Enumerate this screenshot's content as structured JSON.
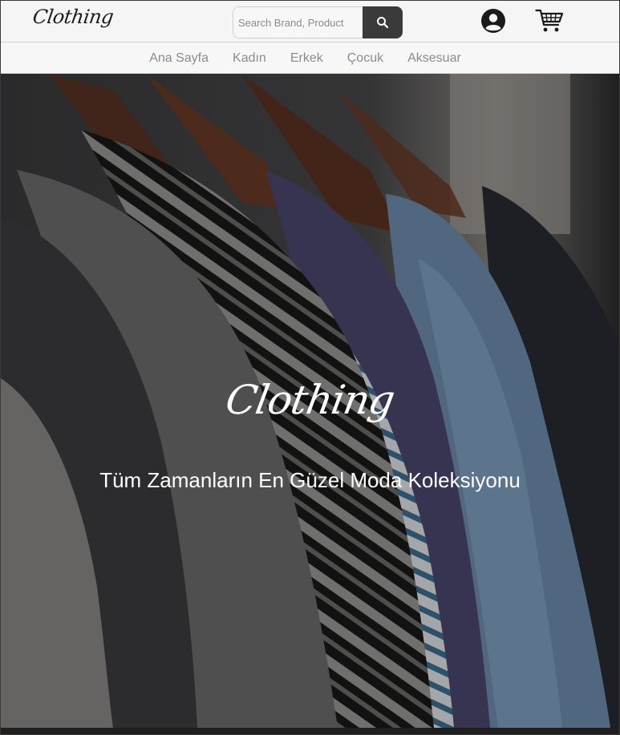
{
  "header": {
    "logo_text": "Clothing",
    "search": {
      "placeholder": "Search Brand, Product",
      "button_icon": "search-icon"
    },
    "user_icon": "user-icon",
    "cart_icon": "cart-icon"
  },
  "nav": {
    "items": [
      {
        "label": "Ana Sayfa"
      },
      {
        "label": "Kadın"
      },
      {
        "label": "Erkek"
      },
      {
        "label": "Çocuk"
      },
      {
        "label": "Aksesuar"
      }
    ]
  },
  "hero": {
    "logo_text": "Clothing",
    "tagline": "Tüm Zamanların En Güzel Moda Koleksiyonu"
  },
  "colors": {
    "search_button": "#3a3a3a",
    "nav_text": "#8c8c8c",
    "hero_text": "#ffffff"
  }
}
